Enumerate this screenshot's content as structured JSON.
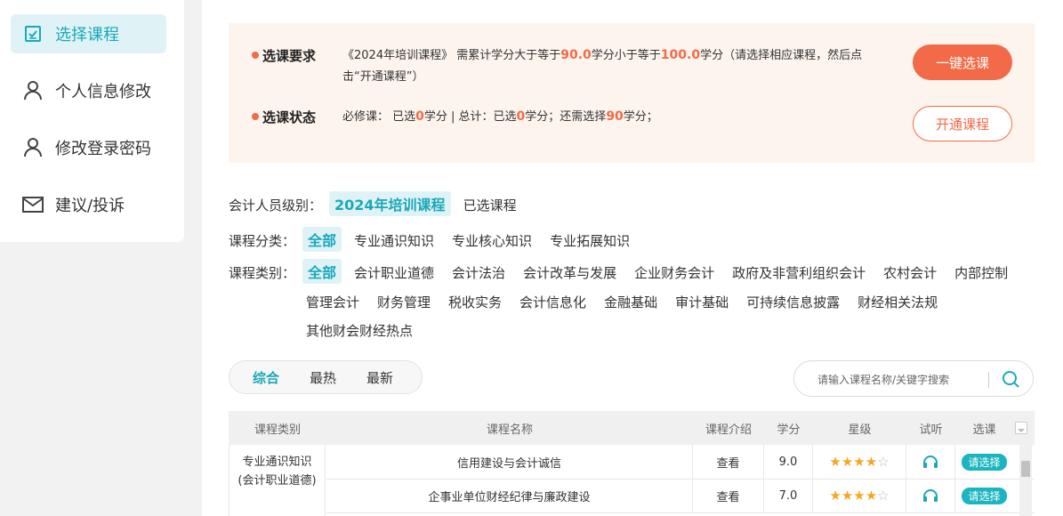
{
  "sidebar": {
    "items": [
      {
        "label": "选择课程",
        "icon": "checkbox-icon"
      },
      {
        "label": "个人信息修改",
        "icon": "user-icon"
      },
      {
        "label": "修改登录密码",
        "icon": "user-icon"
      },
      {
        "label": "建议/投诉",
        "icon": "mail-icon"
      }
    ]
  },
  "requirements": {
    "label1": "选课要求",
    "text1_a": "《2024年培训课程》 需累计学分大于等于",
    "text1_min": "90.0",
    "text1_b": "学分小于等于",
    "text1_max": "100.0",
    "text1_c": "学分（请选择相应课程，然后点",
    "text1_d": "击“开通课程”）",
    "label2": "选课状态",
    "text2_a": "必修课： 已选",
    "text2_req": "0",
    "text2_b": "学分 | 总计：已选",
    "text2_total": "0",
    "text2_c": "学分；还需选择",
    "text2_need": "90",
    "text2_d": "学分；",
    "btn_select_all": "一键选课",
    "btn_activate": "开通课程"
  },
  "filters": {
    "level_label": "会计人员级别：",
    "levels": [
      "2024年培训课程",
      "已选课程"
    ],
    "category_label": "课程分类：",
    "categories": [
      "全部",
      "专业通识知识",
      "专业核心知识",
      "专业拓展知识"
    ],
    "type_label": "课程类别：",
    "types_row1": [
      "全部",
      "会计职业道德",
      "会计法治",
      "会计改革与发展",
      "企业财务会计",
      "政府及非营利组织会计",
      "农村会计",
      "内部控制"
    ],
    "types_row2": [
      "管理会计",
      "财务管理",
      "税收实务",
      "会计信息化",
      "金融基础",
      "审计基础",
      "可持续信息披露",
      "财经相关法规"
    ],
    "types_row3": [
      "其他财会财经热点"
    ]
  },
  "sort": {
    "options": [
      "综合",
      "最热",
      "最新"
    ]
  },
  "search": {
    "placeholder": "请输入课程名称/关键字搜索"
  },
  "table": {
    "headers": [
      "课程类别",
      "课程名称",
      "课程介绍",
      "学分",
      "星级",
      "试听",
      "选课"
    ],
    "category_line1": "专业通识知识",
    "category_line2": "(会计职业道德)",
    "rows": [
      {
        "name": "信用建设与会计诚信",
        "intro": "查看",
        "credit": "9.0",
        "stars": 4,
        "pick": "请选择"
      },
      {
        "name": "企事业单位财经纪律与廉政建设",
        "intro": "查看",
        "credit": "7.0",
        "stars": 4,
        "pick": "请选择"
      }
    ]
  },
  "colors": {
    "accent": "#1aa8b8",
    "orange": "#f26a47"
  }
}
